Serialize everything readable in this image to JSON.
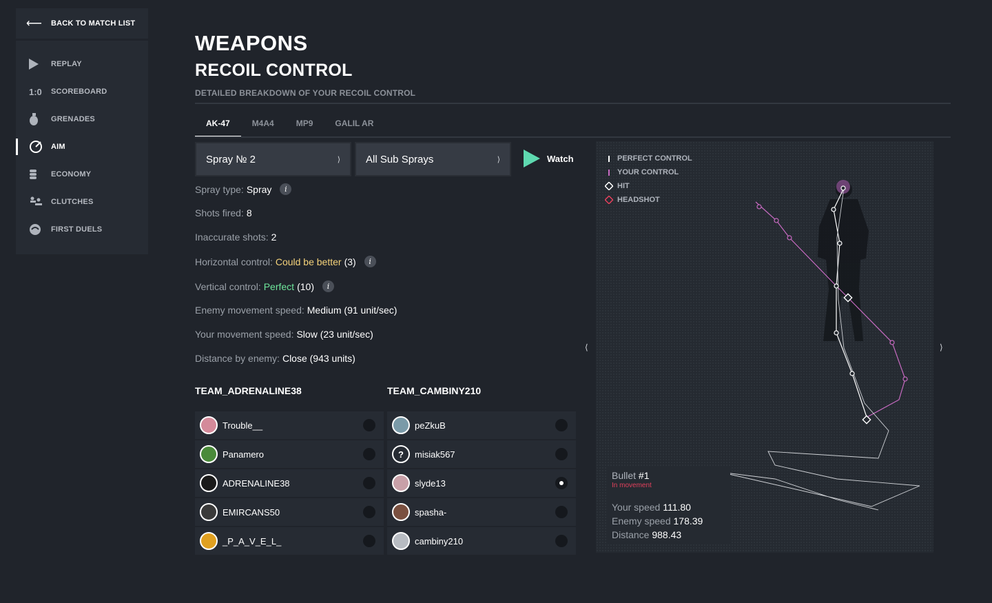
{
  "back": {
    "label": "BACK TO MATCH LIST"
  },
  "nav": {
    "replay": "REPLAY",
    "scoreboard": "SCOREBOARD",
    "scoreboard_icon_text": "1:0",
    "grenades": "GRENADES",
    "aim": "AIM",
    "economy": "ECONOMY",
    "clutches": "CLUTCHES",
    "first_duels": "FIRST DUELS",
    "active": "aim"
  },
  "page": {
    "title": "WEAPONS",
    "subtitle": "RECOIL CONTROL",
    "description": "DETAILED BREAKDOWN OF YOUR RECOIL CONTROL"
  },
  "tabs": [
    "AK-47",
    "M4A4",
    "MP9",
    "GALIL AR"
  ],
  "active_tab": "AK-47",
  "selects": {
    "spray": "Spray № 2",
    "sub_sprays": "All Sub Sprays",
    "chevron": "⟩"
  },
  "watch": {
    "label": "Watch"
  },
  "stats": {
    "spray_type": {
      "label": "Spray type:",
      "value": "Spray"
    },
    "shots_fired": {
      "label": "Shots fired:",
      "value": "8"
    },
    "inaccurate": {
      "label": "Inaccurate shots:",
      "value": "2"
    },
    "horizontal": {
      "label": "Horizontal control:",
      "value": "Could be better",
      "score": "(3)"
    },
    "vertical": {
      "label": "Vertical control:",
      "value": "Perfect",
      "score": "(10)"
    },
    "enemy_speed": {
      "label": "Enemy movement speed:",
      "value": "Medium (91 unit/sec)"
    },
    "your_speed": {
      "label": "Your movement speed:",
      "value": "Slow (23 unit/sec)"
    },
    "distance": {
      "label": "Distance by enemy:",
      "value": "Close (943 units)"
    },
    "info_glyph": "i"
  },
  "teams": {
    "left": {
      "name": "TEAM_ADRENALINE38",
      "players": [
        {
          "name": "Trouble__",
          "color": "#d48a9a",
          "selected": false
        },
        {
          "name": "Panamero",
          "color": "#4a8a3a",
          "selected": false
        },
        {
          "name": "ADRENALINE38",
          "color": "#1a1a1a",
          "selected": false
        },
        {
          "name": "EMIRCANS50",
          "color": "#3a3a3a",
          "selected": false
        },
        {
          "name": "_P_A_V_E_L_",
          "color": "#e0a020",
          "selected": false
        }
      ]
    },
    "right": {
      "name": "TEAM_CAMBINY210",
      "players": [
        {
          "name": "peZkuB",
          "color": "#7a9aa8",
          "selected": false
        },
        {
          "name": "misiak567",
          "color": "#262b33",
          "glyph": "?",
          "selected": false
        },
        {
          "name": "slyde13",
          "color": "#c8a0a8",
          "selected": true
        },
        {
          "name": "spasha-",
          "color": "#7a5040",
          "selected": false
        },
        {
          "name": "cambiny210",
          "color": "#b8bcc2",
          "selected": false
        }
      ]
    }
  },
  "legend": {
    "perfect": "PERFECT CONTROL",
    "yours": "YOUR CONTROL",
    "hit": "HIT",
    "headshot": "HEADSHOT"
  },
  "panel_nav": {
    "prev": "⟨",
    "next": "⟩"
  },
  "bullet": {
    "label": "Bullet",
    "number": "#1",
    "state": "In movement",
    "your_speed_label": "Your speed",
    "your_speed": "111.80",
    "enemy_speed_label": "Enemy speed",
    "enemy_speed": "178.39",
    "distance_label": "Distance",
    "distance": "988.43"
  },
  "colors": {
    "accent_green": "#5ed9b0",
    "yellow": "#f4d27a",
    "green": "#6ee59b",
    "perfect_line": "#ffffff",
    "your_line": "#c86bc2",
    "headshot": "#e2405c"
  }
}
